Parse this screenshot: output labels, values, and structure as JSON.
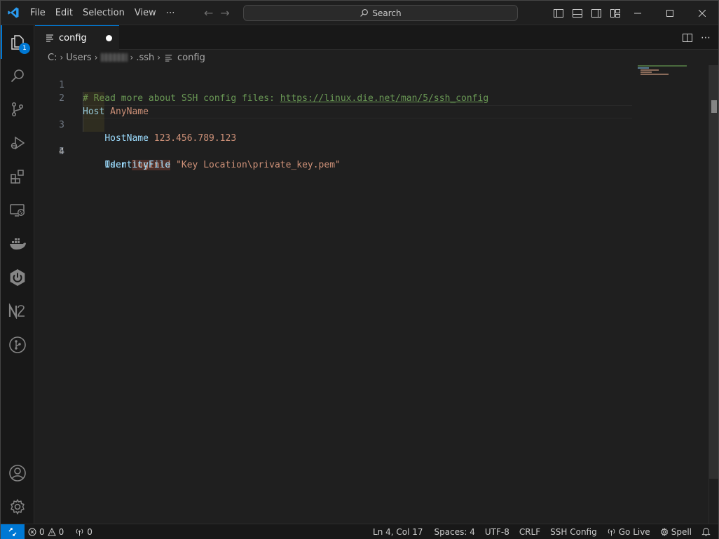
{
  "titlebar": {
    "menu": [
      "File",
      "Edit",
      "Selection",
      "View",
      "⋯"
    ],
    "search_label": "Search",
    "accent_color": "#0078d4"
  },
  "activitybar": {
    "items": [
      {
        "icon": "files-icon",
        "badge": "1"
      },
      {
        "icon": "search-icon"
      },
      {
        "icon": "source-control-icon"
      },
      {
        "icon": "run-debug-icon"
      },
      {
        "icon": "extensions-icon"
      },
      {
        "icon": "remote-explorer-icon"
      },
      {
        "icon": "docker-icon"
      },
      {
        "icon": "power-icon"
      },
      {
        "icon": "n2-icon"
      },
      {
        "icon": "git-graph-icon"
      }
    ],
    "bottom": [
      {
        "icon": "account-icon"
      },
      {
        "icon": "settings-gear-icon"
      }
    ]
  },
  "tab": {
    "label": "config",
    "dirty": true
  },
  "breadcrumb": {
    "drive": "C:",
    "users": "Users",
    "folder": ".ssh",
    "file": "config"
  },
  "editor": {
    "current_line": 4,
    "lines": [
      {
        "n": "1",
        "comment": "# Read more about SSH config files: ",
        "link": "https://linux.die.net/man/5/ssh_config"
      },
      {
        "n": "2",
        "keyword": "Host",
        "value": "AnyName"
      },
      {
        "n": "3",
        "keyword": "HostName",
        "value": "123.456.789.123"
      },
      {
        "n": "4",
        "keyword": "User",
        "value": "loginid"
      },
      {
        "n": "5",
        "keyword": "IdentityFile",
        "value": "\"Key Location\\private_key.pem\""
      }
    ]
  },
  "statusbar": {
    "errors": "0",
    "warnings": "0",
    "ports": "0",
    "position": "Ln 4, Col 17",
    "spaces": "Spaces: 4",
    "encoding": "UTF-8",
    "eol": "CRLF",
    "language": "SSH Config",
    "golive": "Go Live",
    "spell": "Spell"
  }
}
